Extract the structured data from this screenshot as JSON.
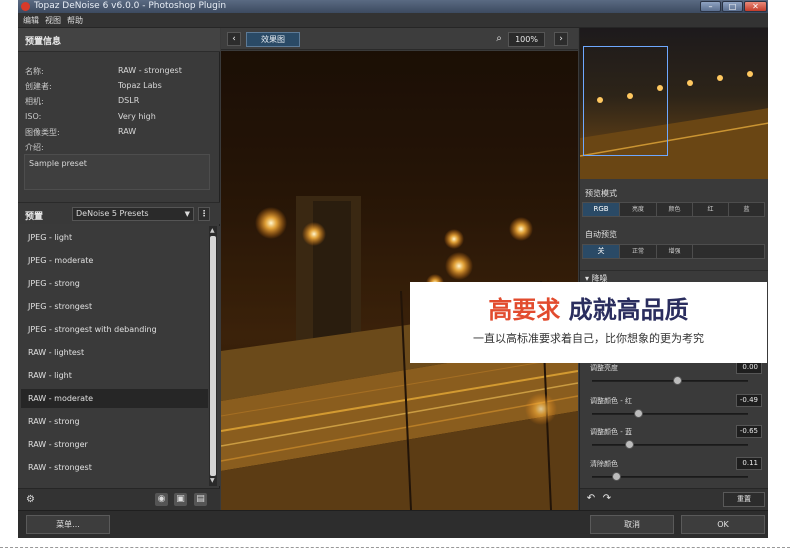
{
  "window": {
    "title": "Topaz DeNoise 6 v6.0.0 - Photoshop Plugin",
    "min_label": "–",
    "max_label": "□",
    "close_label": "✕"
  },
  "menubar": {
    "items": [
      "编辑",
      "视图",
      "帮助"
    ]
  },
  "preset_info": {
    "header": "预置信息",
    "rows": [
      {
        "label": "名称:",
        "value": "RAW - strongest"
      },
      {
        "label": "创建者:",
        "value": "Topaz Labs"
      },
      {
        "label": "相机:",
        "value": "DSLR"
      },
      {
        "label": "ISO:",
        "value": "Very high"
      },
      {
        "label": "图像类型:",
        "value": "RAW"
      }
    ],
    "description_label": "介绍:",
    "description": "Sample preset"
  },
  "presets": {
    "label": "预置",
    "selected_group": "DeNoise 5 Presets",
    "more_label": "⋮",
    "items": [
      "JPEG - light",
      "JPEG - moderate",
      "JPEG - strong",
      "JPEG - strongest",
      "JPEG - strongest with debanding",
      "RAW - lightest",
      "RAW - light",
      "RAW - moderate",
      "RAW - strong",
      "RAW - stronger",
      "RAW - strongest"
    ],
    "selected_index": 7
  },
  "view": {
    "prev_label": "‹",
    "next_label": "›",
    "tab_label": "效果图",
    "zoom": "100%"
  },
  "preview_mode": {
    "label": "预览模式",
    "options": [
      "RGB",
      "亮度",
      "颜色",
      "红",
      "蓝"
    ],
    "selected": 0
  },
  "auto_preview": {
    "label": "自动预览",
    "options": [
      "关",
      "正常",
      "增强"
    ],
    "selected": 0
  },
  "noise_section": {
    "label": "降噪"
  },
  "sliders": [
    {
      "label": "调整亮度",
      "value": "0.00",
      "pos": 0.55
    },
    {
      "label": "调整颜色 - 红",
      "value": "-0.49",
      "pos": 0.3
    },
    {
      "label": "调整颜色 - 蓝",
      "value": "-0.65",
      "pos": 0.24
    },
    {
      "label": "清除颜色",
      "value": "0.11",
      "pos": 0.16
    }
  ],
  "right_footer": {
    "undo": "↶",
    "redo": "↷",
    "reset": "重置"
  },
  "bottom": {
    "menu": "菜单...",
    "cancel": "取消",
    "ok": "OK"
  },
  "promo": {
    "headline_red": "高要求",
    "headline_blue": "成就高品质",
    "subline": "一直以高标准要求着自己，比你想象的更为考究"
  },
  "colors": {
    "accent": "#2a4a66",
    "panel": "#3a3a3a",
    "promo_red": "#e24b2e",
    "promo_blue": "#2a2d5e"
  }
}
